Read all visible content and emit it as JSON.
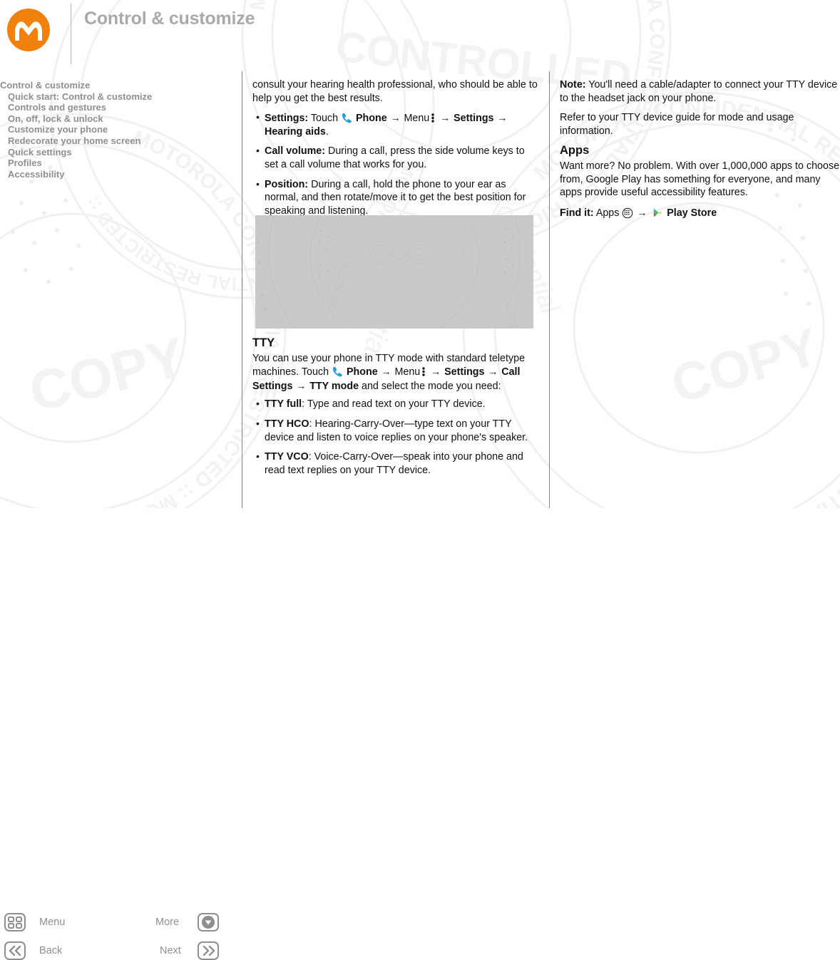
{
  "header": {
    "title": "Control & customize",
    "logo_alt": "motorola-logo",
    "brand_color": "#f2800d"
  },
  "sidebar": {
    "items": [
      {
        "label": "Control & customize",
        "indent": false
      },
      {
        "label": "Quick start: Control & customize",
        "indent": true
      },
      {
        "label": "Controls and gestures",
        "indent": true
      },
      {
        "label": "On, off, lock & unlock",
        "indent": true
      },
      {
        "label": "Customize your phone",
        "indent": true
      },
      {
        "label": "Redecorate your home screen",
        "indent": true
      },
      {
        "label": "Quick settings",
        "indent": true
      },
      {
        "label": "Profiles",
        "indent": true
      },
      {
        "label": "Accessibility",
        "indent": true
      }
    ]
  },
  "middle_column": {
    "intro": "consult your hearing health professional, who should be able to help you get the best results.",
    "hearing_bullets": [
      {
        "term": "Settings:",
        "segments": [
          {
            "t": " Touch ",
            "b": false
          },
          {
            "icon": "phone-icon"
          },
          {
            "t": "Phone",
            "b": true
          },
          {
            "arrow": true
          },
          {
            "t": "Menu",
            "b": false
          },
          {
            "icon": "menu-dots-icon"
          },
          {
            "arrow": true
          },
          {
            "t": "Settings",
            "b": true
          },
          {
            "arrow": true
          },
          {
            "t": "Hearing aids",
            "b": true
          },
          {
            "t": ".",
            "b": false
          }
        ]
      },
      {
        "term": "Call volume:",
        "segments": [
          {
            "t": " During a call, press the side volume keys to set a call volume that works for you.",
            "b": false
          }
        ]
      },
      {
        "term": "Position:",
        "segments": [
          {
            "t": " During a call, hold the phone to your ear as normal, and then rotate/move it to get the best position for speaking and listening.",
            "b": false
          }
        ]
      }
    ],
    "figure_caption": "",
    "tty_heading": "TTY",
    "tty_intro_segments": [
      {
        "t": "You can use your phone in TTY mode with standard teletype machines. Touch ",
        "b": false
      },
      {
        "icon": "phone-icon"
      },
      {
        "t": "Phone",
        "b": true
      },
      {
        "arrow": true
      },
      {
        "t": "Menu",
        "b": false
      },
      {
        "icon": "menu-dots-icon"
      },
      {
        "arrow": true
      },
      {
        "t": "Settings",
        "b": true
      },
      {
        "arrow": true
      },
      {
        "t": "Call Settings",
        "b": true
      },
      {
        "arrow": true
      },
      {
        "t": "TTY mode",
        "b": true
      },
      {
        "t": " and select the mode you need:",
        "b": false
      }
    ],
    "tty_bullets": [
      {
        "term": "TTY full",
        "rest": ": Type and read text on your TTY device."
      },
      {
        "term": "TTY HCO",
        "rest": ": Hearing-Carry-Over—type text on your TTY device and listen to voice replies on your phone's speaker."
      },
      {
        "term": "TTY VCO",
        "rest": ": Voice-Carry-Over—speak into your phone and read text replies on your TTY device."
      }
    ]
  },
  "right_column": {
    "note_term": "Note:",
    "note_text": " You'll need a cable/adapter to connect your TTY device to the headset jack on your phone.",
    "refer_text": "Refer to your TTY device guide for mode and usage information.",
    "apps_heading": "Apps",
    "apps_text": "Want more? No problem. With over 1,000,000 apps to choose from, Google Play has something for everyone, and many apps provide useful accessibility features.",
    "find_it_term": "Find it:",
    "find_it_segments": [
      {
        "t": " Apps ",
        "b": false
      },
      {
        "icon": "apps-grid-icon"
      },
      {
        "arrow": true
      },
      {
        "icon": "play-store-icon"
      },
      {
        "t": "Play Store",
        "b": true
      }
    ]
  },
  "footer": {
    "menu_label": "Menu",
    "more_label": "More",
    "back_label": "Back",
    "next_label": "Next",
    "menu_icon": "grid-icon",
    "more_icon": "chevron-down-circle-icon",
    "back_icon": "double-chevron-left-icon",
    "next_icon": "double-chevron-right-icon"
  },
  "watermark": {
    "ring_text": "MOTOROLA CONFIDENTIAL RESTRICTED :: ",
    "big_words": [
      "CONTROLLED",
      "COPY",
      "Confidential"
    ],
    "color": "#f2f2f2"
  }
}
